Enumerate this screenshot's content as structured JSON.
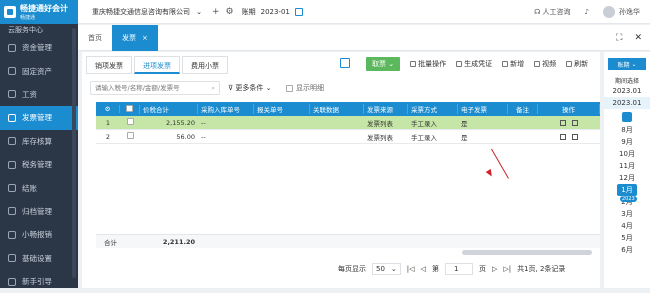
{
  "app": {
    "logo_name": "畅捷通好会计",
    "logo_sub": "畅捷通"
  },
  "sidebar": {
    "items": [
      {
        "label": "云服务中心"
      },
      {
        "label": "资金管理"
      },
      {
        "label": "固定资产"
      },
      {
        "label": "工资"
      },
      {
        "label": "发票管理"
      },
      {
        "label": "库存核算"
      },
      {
        "label": "税务管理"
      },
      {
        "label": "结账"
      },
      {
        "label": "归档管理"
      },
      {
        "label": "小畅报销"
      },
      {
        "label": "基础设置"
      },
      {
        "label": "新手引导"
      }
    ]
  },
  "topbar": {
    "company": "重庆畅捷交通信息咨询有限公司",
    "add": "+",
    "period_label": "账期",
    "period_value": "2023-01",
    "support": "人工咨询",
    "user": "孙逸华"
  },
  "tabs": [
    {
      "label": "首页"
    },
    {
      "label": "发票"
    }
  ],
  "tabs_close": "×",
  "tabbar_end": {
    "fullscreen": "⛶",
    "close": "✕"
  },
  "subtabs": [
    {
      "label": "销项发票"
    },
    {
      "label": "进项发票"
    },
    {
      "label": "费用小票"
    }
  ],
  "toolbar": {
    "new": "取票",
    "batch": "批量操作",
    "voucher": "生成凭证",
    "add": "新增",
    "video": "视频",
    "refresh": "刷新"
  },
  "search": {
    "placeholder": "请输入税号/名称/金额/发票号"
  },
  "filters": {
    "more": "更多条件",
    "show_detail": "显示明细"
  },
  "table": {
    "columns": [
      "序",
      "",
      "价税合计",
      "采购入库单号",
      "报关单号",
      "关联数据",
      "发票来源",
      "采票方式",
      "电子发票",
      "备注",
      "操作"
    ],
    "rows": [
      {
        "no": "1",
        "total": "2,155.20",
        "inbound": "--",
        "customs": "",
        "link": "",
        "source": "发票列表",
        "method": "手工录入",
        "e_invoice": "是",
        "remark": "",
        "selected": true
      },
      {
        "no": "2",
        "total": "56.00",
        "inbound": "--",
        "customs": "",
        "link": "",
        "source": "发票列表",
        "method": "手工录入",
        "e_invoice": "是",
        "remark": "",
        "selected": false
      }
    ],
    "sum_label": "合计",
    "sum_value": "2,211.20"
  },
  "pager": {
    "per_page_label": "每页显示",
    "per_page": "50",
    "page_prefix": "第",
    "page": "1",
    "page_suffix": "页",
    "summary": "共1页, 2条记录",
    "first": "|◁",
    "prev": "◁",
    "next": "▷",
    "last": "▷|"
  },
  "right_panel": {
    "button": "账期",
    "caption": "期间选择",
    "years": [
      "2023.01",
      "2023.01"
    ],
    "year_tag": "2023",
    "months": [
      "8月",
      "9月",
      "10月",
      "11月",
      "12月",
      "1月",
      "2月",
      "3月",
      "4月",
      "5月",
      "6月"
    ],
    "current_month": "1月"
  },
  "colors": {
    "accent": "#1b8ccf",
    "selected_row": "#c5e6a6",
    "sidebar": "#2b3646",
    "new_button": "#5cb85c"
  }
}
